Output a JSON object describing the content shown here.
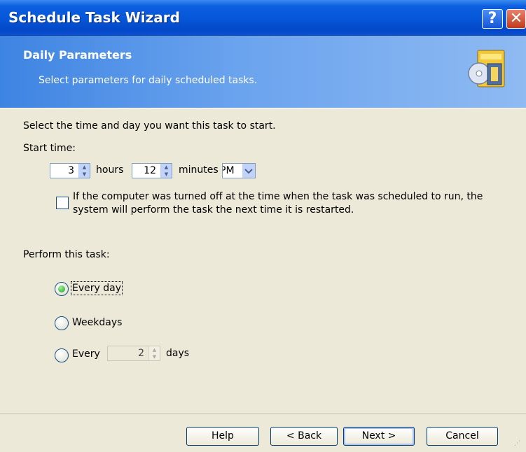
{
  "window": {
    "title": "Schedule Task Wizard",
    "help_glyph": "?",
    "close_glyph": "✕"
  },
  "header": {
    "title": "Daily Parameters",
    "subtitle": "Select parameters for daily scheduled tasks.",
    "icon": "schedule-wizard-icon"
  },
  "body": {
    "instruction": "Select the time and day you want this task to start.",
    "start_time": {
      "label": "Start time:",
      "hours_value": "3",
      "hours_label": "hours",
      "minutes_value": "12",
      "minutes_label": "minutes",
      "ampm_value": "PM"
    },
    "catchup_checkbox": {
      "label_line1": "If the computer was turned off at the time when the task was scheduled to run, the",
      "label_line2": "system will perform the task the next time it is restarted.",
      "checked": false
    },
    "perform": {
      "label": "Perform this task:",
      "options": [
        {
          "label": "Every day",
          "selected": true
        },
        {
          "label": "Weekdays",
          "selected": false
        },
        {
          "label": "Every",
          "selected": false
        }
      ],
      "interval_value": "2",
      "interval_suffix": "days"
    }
  },
  "footer": {
    "help": "Help",
    "back": "< Back",
    "next": "Next >",
    "cancel": "Cancel"
  },
  "colors": {
    "titlebar": "#0656d8",
    "header": "#6aa3ee",
    "dialog_face": "#ece9d8",
    "radio_selected": "#21a121"
  }
}
